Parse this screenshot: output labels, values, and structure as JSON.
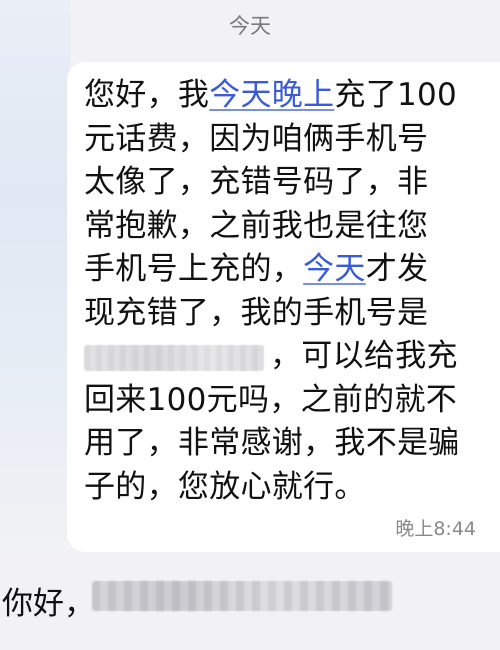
{
  "date_header": "今天",
  "message": {
    "lines": [
      {
        "parts": [
          {
            "text": "您好，我",
            "link": false
          },
          {
            "text": "今天晚上",
            "link": true
          },
          {
            "text": "充了100",
            "link": false
          }
        ]
      },
      {
        "parts": [
          {
            "text": "元话费，因为咱俩手机号",
            "link": false
          }
        ]
      },
      {
        "parts": [
          {
            "text": "太像了，充错号码了，非",
            "link": false
          }
        ]
      },
      {
        "parts": [
          {
            "text": "常抱歉，之前我也是往您",
            "link": false
          }
        ]
      },
      {
        "parts": [
          {
            "text": "手机号上充的，",
            "link": false
          },
          {
            "text": "今天",
            "link": true
          },
          {
            "text": "才发",
            "link": false
          }
        ]
      },
      {
        "parts": [
          {
            "text": "现充错了，我的手机号是",
            "link": false
          }
        ]
      },
      {
        "parts": [
          {
            "text": "，可以给我充",
            "link": false
          }
        ]
      },
      {
        "parts": [
          {
            "text": "回来100元吗，之前的就不",
            "link": false
          }
        ]
      },
      {
        "parts": [
          {
            "text": "用了，非常感谢，我不是骗",
            "link": false
          }
        ]
      },
      {
        "parts": [
          {
            "text": "子的，您放心就行。",
            "link": false
          }
        ]
      }
    ],
    "time": "晚上8:44"
  },
  "incoming_preview": {
    "text": "你好，"
  },
  "colors": {
    "link": "#3a5bd6",
    "bubble": "#ffffff",
    "background": "#f2f2f4"
  }
}
